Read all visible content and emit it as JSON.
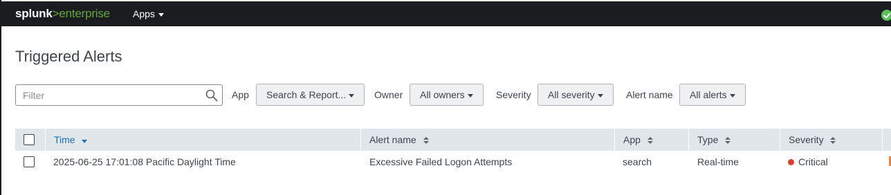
{
  "brand": {
    "part1": "splunk",
    "part2": ">",
    "part3": "enterprise"
  },
  "nav": {
    "apps_label": "Apps"
  },
  "status": {
    "icon": "check-circle-icon",
    "color": "#5cc05c"
  },
  "page": {
    "title": "Triggered Alerts"
  },
  "filters": {
    "search_placeholder": "Filter",
    "app_label": "App",
    "app_value": "Search & Report...",
    "owner_label": "Owner",
    "owner_value": "All owners",
    "severity_label": "Severity",
    "severity_value": "All severity",
    "alert_name_label": "Alert name",
    "alert_name_value": "All alerts"
  },
  "table": {
    "columns": [
      "Time",
      "Alert name",
      "App",
      "Type",
      "Severity"
    ],
    "sorted_column": "Time",
    "rows": [
      {
        "time": "2025-06-25 17:01:08 Pacific Daylight Time",
        "alert_name": "Excessive Failed Logon Attempts",
        "app": "search",
        "type": "Real-time",
        "severity": "Critical",
        "severity_color": "#d6412e"
      }
    ]
  },
  "colors": {
    "topbar": "#1a1c20",
    "brand_accent": "#65a637",
    "link": "#1a6fb5",
    "header_bg": "#e1e6eb"
  }
}
